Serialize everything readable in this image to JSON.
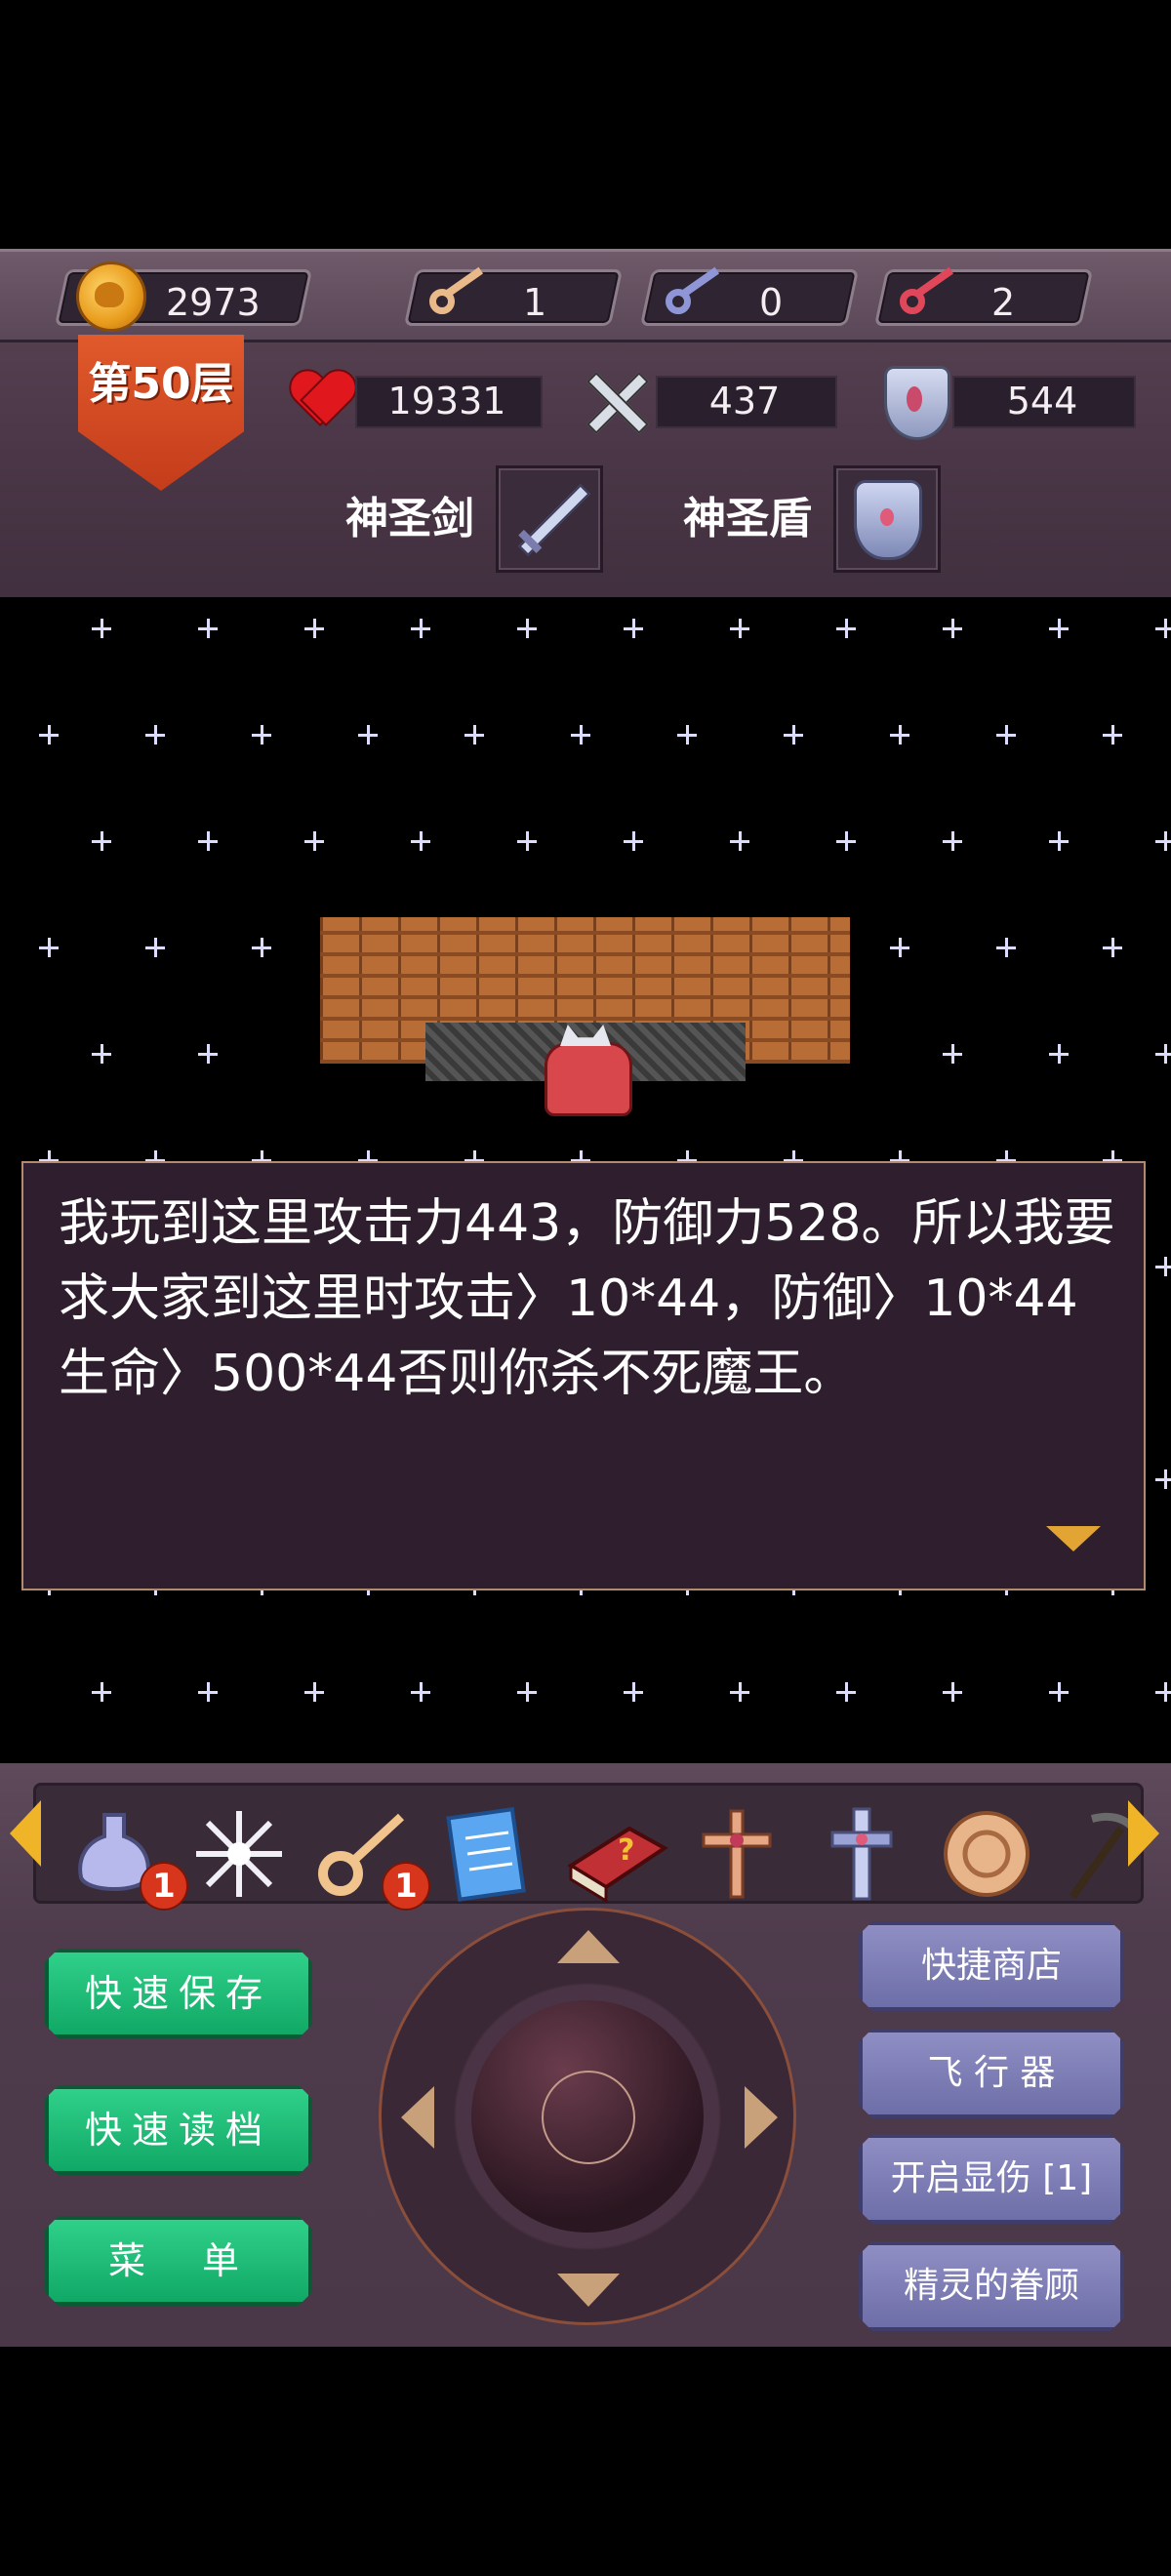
{
  "resources": {
    "gold": "2973",
    "yellow_keys": "1",
    "blue_keys": "0",
    "red_keys": "2"
  },
  "floor": {
    "label": "第50层"
  },
  "stats": {
    "hp": "19331",
    "attack": "437",
    "defense": "544"
  },
  "equipment": {
    "weapon_label": "神圣剑",
    "shield_label": "神圣盾"
  },
  "dialog": {
    "text": "我玩到这里攻击力443，防御力528。所以我要求大家到这里时攻击〉10*44，防御〉10*44 生命〉500*44否则你杀不死魔王。"
  },
  "items": [
    {
      "name": "holy-water-icon",
      "count": "1"
    },
    {
      "name": "snowflake-icon",
      "count": ""
    },
    {
      "name": "golden-key-icon",
      "count": "1"
    },
    {
      "name": "notepad-icon",
      "count": ""
    },
    {
      "name": "monster-book-icon",
      "count": ""
    },
    {
      "name": "cross-icon",
      "count": ""
    },
    {
      "name": "holy-sword-cross-icon",
      "count": ""
    },
    {
      "name": "coin-disc-icon",
      "count": ""
    },
    {
      "name": "pickaxe-icon",
      "count": ""
    }
  ],
  "buttons": {
    "quick_save": "快速保存",
    "quick_load": "快速读档",
    "menu": "菜　单",
    "shop": "快捷商店",
    "fly": "飞 行 器",
    "damage": "开启显伤 [1]",
    "fairy": "精灵的眷顾"
  },
  "colors": {
    "accent_gold": "#f0b428",
    "button_green": "#11a866",
    "button_purple": "#6e6ea8"
  }
}
